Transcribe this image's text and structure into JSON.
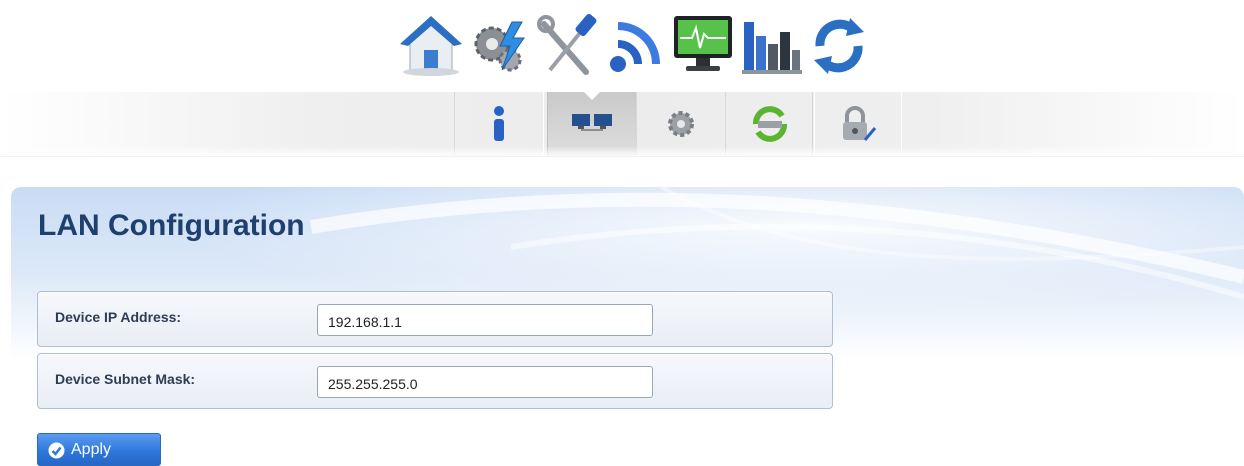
{
  "top_nav": {
    "items": [
      {
        "icon": "home-icon"
      },
      {
        "icon": "gears-lightning-icon"
      },
      {
        "icon": "tools-icon"
      },
      {
        "icon": "wireless-icon"
      },
      {
        "icon": "monitor-icon"
      },
      {
        "icon": "bar-chart-icon"
      },
      {
        "icon": "refresh-icon"
      }
    ]
  },
  "sub_nav": {
    "items": [
      {
        "icon": "info-icon",
        "active": false
      },
      {
        "icon": "network-computers-icon",
        "active": true
      },
      {
        "icon": "gear-icon",
        "active": false
      },
      {
        "icon": "sync-icon",
        "active": false
      },
      {
        "icon": "lock-icon",
        "active": false
      }
    ]
  },
  "page": {
    "title": "LAN Configuration"
  },
  "form": {
    "ip_label": "Device IP Address:",
    "ip_value": "192.168.1.1",
    "mask_label": "Device Subnet Mask:",
    "mask_value": "255.255.255.0"
  },
  "actions": {
    "apply_label": "Apply"
  },
  "colors": {
    "title": "#1f3f6e",
    "apply_button": "#2f78dc",
    "panel_top": "#c9dcf5"
  }
}
